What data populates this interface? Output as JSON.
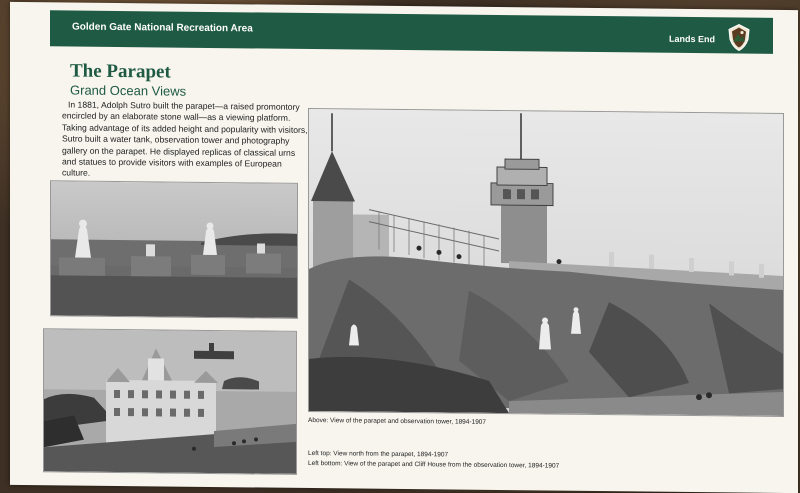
{
  "header": {
    "agency": "Golden Gate National Recreation Area",
    "site": "Lands End"
  },
  "panel": {
    "title": "The Parapet",
    "subtitle": "Grand Ocean Views",
    "body": "In 1881, Adolph Sutro built the parapet—a raised promontory encircled by an elaborate stone wall—as a viewing platform. Taking advantage of its added height and popularity with visitors, Sutro built a water tank, observation tower and photography gallery on the parapet. He displayed replicas of classical urns and statues to provide visitors with examples of European culture."
  },
  "captions": {
    "above": "Above: View of the parapet and observation tower, 1894-1907",
    "left_top": "Left top:  View north from the parapet, 1894-1907",
    "left_bottom": "Left bottom: View of the parapet and Cliff House from the observation tower, 1894-1907"
  },
  "colors": {
    "band": "#1f5a44",
    "panel": "#f7f5ee"
  },
  "icons": {
    "logo": "arrowhead-icon"
  }
}
